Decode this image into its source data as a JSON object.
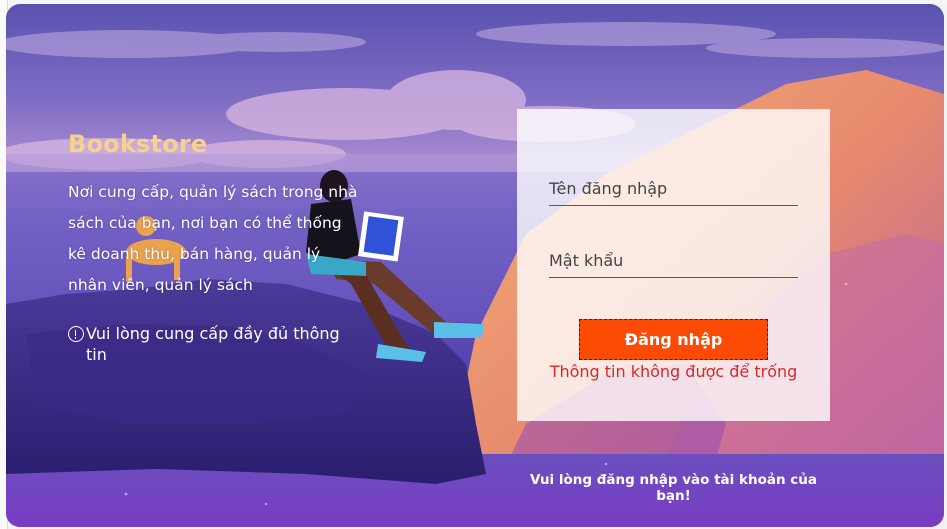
{
  "app": {
    "brand": "Bookstore",
    "tagline": "Nơi cung cấp, quản lý sách trong nhà sách của bạn, nơi bạn có thể thống kê doanh thu, bán hàng, quản lý nhân viên, quản lý sách",
    "warning": "Vui lòng cung cấp đầy đủ thông tin",
    "warning_icon": "exclamation-circle-icon"
  },
  "login": {
    "username_placeholder": "Tên đăng nhập",
    "username_value": "",
    "password_placeholder": "Mật khẩu",
    "password_value": "",
    "submit_label": "Đăng nhập",
    "error": "Thông tin không được để trống",
    "footer_hint": "Vui lòng đăng nhập vào tài khoản của bạn!"
  },
  "colors": {
    "brand": "#f7d28a",
    "button": "#fb4b05",
    "error": "#d52a2a"
  }
}
